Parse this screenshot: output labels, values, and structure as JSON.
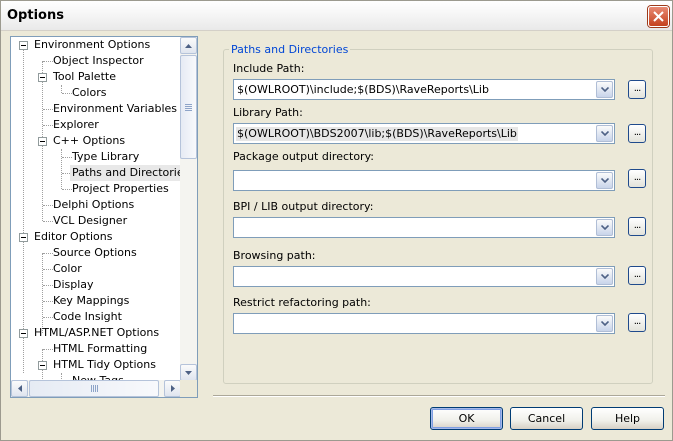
{
  "window": {
    "title": "Options",
    "close_icon": "close-icon"
  },
  "tree": {
    "items": [
      {
        "label": "Environment Options"
      },
      {
        "label": "Object Inspector"
      },
      {
        "label": "Tool Palette"
      },
      {
        "label": "Colors"
      },
      {
        "label": "Environment Variables"
      },
      {
        "label": "Explorer"
      },
      {
        "label": "C++ Options"
      },
      {
        "label": "Type Library"
      },
      {
        "label": "Paths and Directories",
        "selected": true
      },
      {
        "label": "Project Properties"
      },
      {
        "label": "Delphi Options"
      },
      {
        "label": "VCL Designer"
      },
      {
        "label": "Editor Options"
      },
      {
        "label": "Source Options"
      },
      {
        "label": "Color"
      },
      {
        "label": "Display"
      },
      {
        "label": "Key Mappings"
      },
      {
        "label": "Code Insight"
      },
      {
        "label": "HTML/ASP.NET Options"
      },
      {
        "label": "HTML Formatting"
      },
      {
        "label": "HTML Tidy Options"
      },
      {
        "label": "New Tags"
      }
    ]
  },
  "group": {
    "title": "Paths and Directories",
    "fields": [
      {
        "label": "Include Path:",
        "value": "$(OWLROOT)\\include;$(BDS)\\RaveReports\\Lib"
      },
      {
        "label": "Library Path:",
        "value": "$(OWLROOT)\\BDS2007\\lib;$(BDS)\\RaveReports\\Lib"
      },
      {
        "label": "Package output directory:",
        "value": ""
      },
      {
        "label": "BPI / LIB output directory:",
        "value": ""
      },
      {
        "label": "Browsing path:",
        "value": ""
      },
      {
        "label": "Restrict refactoring path:",
        "value": ""
      }
    ],
    "browse_label": "..."
  },
  "buttons": {
    "ok": "OK",
    "cancel": "Cancel",
    "help": "Help"
  },
  "colors": {
    "group_title": "#0046d5",
    "close_button": "#c4411e"
  }
}
